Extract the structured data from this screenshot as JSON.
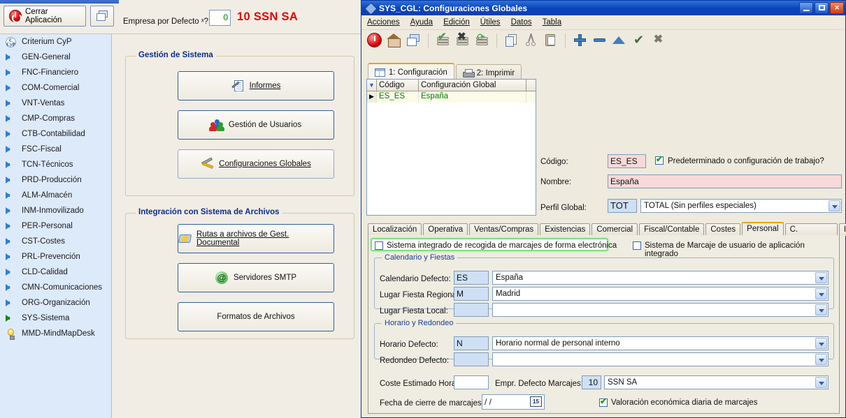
{
  "app": {
    "close_button": "Cerrar Aplicación",
    "windows_button_icon": "windows-cascade-icon",
    "default_company_label": "Empresa por Defecto ˣ?",
    "default_company_value": "0",
    "company_name": "10 SSN SA",
    "accent_red": "#e80000",
    "accent_blue": "#0a2f8a"
  },
  "sidebar": {
    "items": [
      {
        "label": "Criterium CyP",
        "icon": "logo-icon",
        "active": false
      },
      {
        "label": "GEN-General",
        "icon": "blue-arrow-icon",
        "active": false
      },
      {
        "label": "FNC-Financiero",
        "icon": "blue-arrow-icon",
        "active": false
      },
      {
        "label": "COM-Comercial",
        "icon": "blue-arrow-icon",
        "active": false
      },
      {
        "label": "VNT-Ventas",
        "icon": "blue-arrow-icon",
        "active": false
      },
      {
        "label": "CMP-Compras",
        "icon": "blue-arrow-icon",
        "active": false
      },
      {
        "label": "CTB-Contabilidad",
        "icon": "blue-arrow-icon",
        "active": false
      },
      {
        "label": "FSC-Fiscal",
        "icon": "blue-arrow-icon",
        "active": false
      },
      {
        "label": "TCN-Técnicos",
        "icon": "blue-arrow-icon",
        "active": false
      },
      {
        "label": "PRD-Producción",
        "icon": "blue-arrow-icon",
        "active": false
      },
      {
        "label": "ALM-Almacén",
        "icon": "blue-arrow-icon",
        "active": false
      },
      {
        "label": "INM-Inmovilizado",
        "icon": "blue-arrow-icon",
        "active": false
      },
      {
        "label": "PER-Personal",
        "icon": "blue-arrow-icon",
        "active": false
      },
      {
        "label": "CST-Costes",
        "icon": "blue-arrow-icon",
        "active": false
      },
      {
        "label": "PRL-Prevención",
        "icon": "blue-arrow-icon",
        "active": false
      },
      {
        "label": "CLD-Calidad",
        "icon": "blue-arrow-icon",
        "active": false
      },
      {
        "label": "CMN-Comunicaciones",
        "icon": "blue-arrow-icon",
        "active": false
      },
      {
        "label": "ORG-Organización",
        "icon": "blue-arrow-icon",
        "active": false
      },
      {
        "label": "SYS-Sistema",
        "icon": "green-arrow-icon",
        "active": true
      },
      {
        "label": "MMD-MindMapDesk",
        "icon": "lightbulb-icon",
        "active": false
      }
    ]
  },
  "content": {
    "group_system": {
      "title": "Gestión de Sistema",
      "buttons": [
        {
          "label": "Informes",
          "icon": "report-icon"
        },
        {
          "label": "Gestión de Usuarios",
          "icon": "users-icon"
        },
        {
          "label": "Configuraciones Globales",
          "icon": "tools-icon"
        }
      ]
    },
    "group_files": {
      "title": "Integración con Sistema de Archivos",
      "buttons": [
        {
          "label": "Rutas a archivos de Gest. Documental",
          "icon": "folder-icon"
        },
        {
          "label": "Servidores SMTP",
          "icon": "at-icon"
        },
        {
          "label": "Formatos de Archivos",
          "icon": ""
        }
      ]
    }
  },
  "dialog": {
    "title": "SYS_CGL: Configuraciones Globales",
    "title_icon": "app-icon",
    "window_buttons": [
      "minimize-button",
      "maximize-button",
      "close-button"
    ],
    "menu": [
      "Acciones",
      "Ayuda",
      "Edición",
      "Útiles",
      "Datos",
      "Tabla"
    ],
    "toolbar_icons": [
      "exit-icon",
      "home-icon",
      "windows-icon",
      "approve-stack-icon",
      "reject-stack-icon",
      "refresh-stack-icon",
      "copy-icon",
      "cut-icon",
      "paste-icon",
      "add-icon",
      "remove-icon",
      "up-icon",
      "confirm-icon",
      "cancel-icon"
    ],
    "inner_tabs": [
      {
        "label": "1: Configuración",
        "icon": "grid-icon",
        "active": true
      },
      {
        "label": "2: Imprimir",
        "icon": "printer-icon",
        "active": false
      }
    ],
    "grid": {
      "columns": [
        "Código",
        "Configuración Global"
      ],
      "rows": [
        {
          "codigo": "ES_ES",
          "config": "España",
          "selected": true
        }
      ]
    },
    "fields": {
      "codigo_label": "Código:",
      "codigo_value": "ES_ES",
      "predeterminado_label": "Predeterminado o configuración de trabajo?",
      "predeterminado_checked": true,
      "nombre_label": "Nombre:",
      "nombre_value": "España",
      "perfil_label": "Perfil Global:",
      "perfil_code": "TOT",
      "perfil_value": "TOTAL (Sin perfiles especiales)"
    },
    "bottom_tabs": [
      {
        "label": "Localización",
        "active": false
      },
      {
        "label": "Operativa",
        "active": false
      },
      {
        "label": "Ventas/Compras",
        "active": false
      },
      {
        "label": "Existencias",
        "active": false
      },
      {
        "label": "Comercial",
        "active": false
      },
      {
        "label": "Fiscal/Contable",
        "active": false
      },
      {
        "label": "Costes",
        "active": false
      },
      {
        "label": "Personal",
        "active": true
      },
      {
        "label": "C. Documental",
        "active": false
      },
      {
        "label": "Interfaz",
        "active": false
      }
    ],
    "personal": {
      "chk_marcajes_label": "Sistema integrado de recogida de marcajes de forma electrónica",
      "chk_marcajes_checked": false,
      "chk_marcaje_usuario_label": "Sistema de Marcaje de usuario de aplicación integrado",
      "chk_marcaje_usuario_checked": false,
      "group_calendar": {
        "title": "Calendario y Fiestas",
        "rows": [
          {
            "label": "Calendario Defecto:",
            "code": "ES",
            "value": "España"
          },
          {
            "label": "Lugar Fiesta Regional:",
            "code": "M",
            "value": "Madrid"
          },
          {
            "label": "Lugar Fiesta Local:",
            "code": "",
            "value": ""
          }
        ]
      },
      "group_horario": {
        "title": "Horario y Redondeo",
        "rows": [
          {
            "label": "Horario Defecto:",
            "code": "N",
            "value": "Horario normal de personal interno"
          },
          {
            "label": "Redondeo Defecto:",
            "code": "",
            "value": ""
          }
        ]
      },
      "coste_label": "Coste Estimado Hora:",
      "coste_value": "",
      "empr_label": "Empr. Defecto Marcajes:",
      "empr_code": "10",
      "empr_value": "SSN SA",
      "fecha_label": "Fecha de cierre de marcajes:",
      "fecha_value": "/  /",
      "fecha_icon": "calendar-icon",
      "chk_valoracion_label": "Valoración económica diaria de marcajes",
      "chk_valoracion_checked": true
    }
  }
}
